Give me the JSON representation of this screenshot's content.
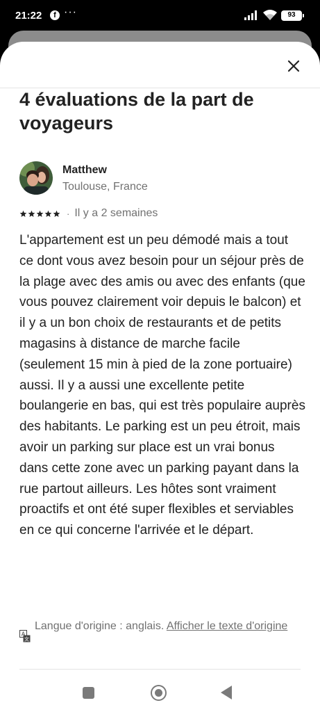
{
  "status_bar": {
    "time": "21:22",
    "app_icon": "f",
    "more": "···",
    "battery": "93"
  },
  "modal": {
    "title": "4 évaluations de la part de voyageurs"
  },
  "review": {
    "name": "Matthew",
    "location": "Toulouse, France",
    "rating": 5,
    "separator": "·",
    "date": "Il y a 2 semaines",
    "text": "L'appartement est un peu démodé mais a tout ce dont vous avez besoin pour un séjour près de la plage avec des amis ou avec des enfants (que vous pouvez clairement voir depuis le balcon) et il y a un bon choix de restaurants et de petits magasins à distance de marche facile (seulement 15 min à pied de la zone portuaire) aussi. Il y a aussi une excellente petite boulangerie en bas, qui est très populaire auprès des habitants. Le parking est un peu étroit, mais avoir un parking sur place est un vrai bonus dans cette zone avec un parking payant dans la rue partout ailleurs. Les hôtes sont vraiment proactifs et ont été super flexibles et serviables en ce qui concerne l'arrivée et le départ.",
    "translation_note": "Langue d'origine : anglais.",
    "translation_link": "Afficher le texte d'origine"
  },
  "colors": {
    "text_primary": "#222222",
    "text_secondary": "#717171",
    "divider": "#e4e4e4",
    "nav_icon": "#7a7a7a"
  },
  "icons": {
    "close": "close-icon",
    "star": "star-icon",
    "translate": "translate-icon",
    "nav_recents": "square-icon",
    "nav_home": "home-circle-icon",
    "nav_back": "back-triangle-icon"
  }
}
